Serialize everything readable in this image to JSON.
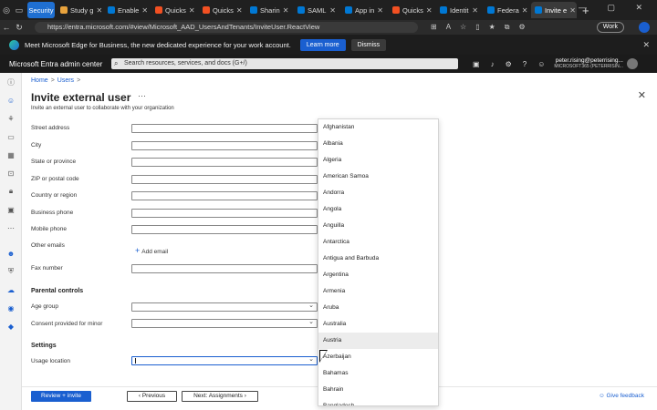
{
  "browser": {
    "tabs": [
      {
        "label": "Security",
        "color": "#1f6fd1",
        "type": "security"
      },
      {
        "label": "Study g",
        "color": "#e8a33d"
      },
      {
        "label": "Enable",
        "color": "#0078d4"
      },
      {
        "label": "Quicks",
        "color": "#f25022"
      },
      {
        "label": "Quicks",
        "color": "#f25022"
      },
      {
        "label": "Sharin",
        "color": "#0078d4"
      },
      {
        "label": "SAML",
        "color": "#0078d4"
      },
      {
        "label": "App in",
        "color": "#0078d4"
      },
      {
        "label": "Quicks",
        "color": "#f25022"
      },
      {
        "label": "Identit",
        "color": "#0078d4"
      },
      {
        "label": "Federa",
        "color": "#0078d4"
      },
      {
        "label": "Invite e",
        "color": "#0078d4",
        "active": true
      }
    ],
    "url": "https://entra.microsoft.com/#view/Microsoft_AAD_UsersAndTenants/InviteUser.ReactView",
    "profile_button": "Work"
  },
  "promo_bar": {
    "message": "Meet Microsoft Edge for Business, the new dedicated experience for your work account.",
    "learn_more": "Learn more",
    "dismiss": "Dismiss"
  },
  "portal": {
    "app_name": "Microsoft Entra admin center",
    "search_placeholder": "Search resources, services, and docs (G+/)",
    "user_name": "peter.rising@peterrising...",
    "user_tenant": "MICROSOFT365 (PETERRISIN..."
  },
  "breadcrumb": {
    "home": "Home",
    "users": "Users"
  },
  "page": {
    "title": "Invite external user",
    "subtitle": "Invite an external user to collaborate with your organization"
  },
  "form": {
    "street_address": "Street address",
    "city": "City",
    "state": "State or province",
    "zip": "ZIP or postal code",
    "country": "Country or region",
    "business_phone": "Business phone",
    "mobile_phone": "Mobile phone",
    "other_emails": "Other emails",
    "add_email": "Add email",
    "fax": "Fax number",
    "parental_controls": "Parental controls",
    "age_group": "Age group",
    "consent": "Consent provided for minor",
    "settings": "Settings",
    "usage_location": "Usage location"
  },
  "dropdown": {
    "options": [
      "Afghanistan",
      "Albania",
      "Algeria",
      "American Samoa",
      "Andorra",
      "Angola",
      "Anguilla",
      "Antarctica",
      "Antigua and Barbuda",
      "Argentina",
      "Armenia",
      "Aruba",
      "Australia",
      "Austria",
      "Azerbaijan",
      "Bahamas",
      "Bahrain",
      "Bangladesh"
    ],
    "hovered": "Austria"
  },
  "footer": {
    "review_invite": "Review + invite",
    "previous": "Previous",
    "next": "Next: Assignments",
    "feedback": "Give feedback"
  }
}
